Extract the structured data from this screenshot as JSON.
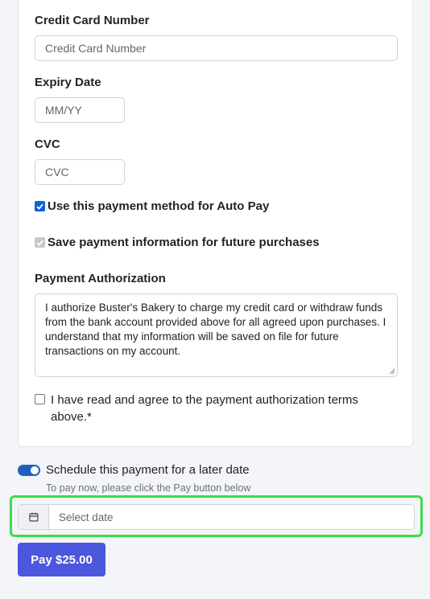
{
  "card_number": {
    "label": "Credit Card Number",
    "placeholder": "Credit Card Number"
  },
  "expiry": {
    "label": "Expiry Date",
    "placeholder": "MM/YY"
  },
  "cvc": {
    "label": "CVC",
    "placeholder": "CVC"
  },
  "auto_pay": {
    "label": "Use this payment method for Auto Pay",
    "checked": true
  },
  "save_info": {
    "label": "Save payment information for future purchases",
    "checked": true,
    "disabled": true
  },
  "authorization": {
    "label": "Payment Authorization",
    "text": "I authorize Buster's Bakery to charge my credit card or withdraw funds from the bank account provided above for all agreed upon purchases. I understand that my information will be saved on file for future transactions on my account."
  },
  "agree": {
    "label": "I have read and agree to the payment authorization terms above.*",
    "checked": false
  },
  "schedule": {
    "label": "Schedule this payment for a later date",
    "enabled": true,
    "hint": "To pay now, please click the Pay button below"
  },
  "date_picker": {
    "placeholder": "Select date",
    "icon": "calendar-icon"
  },
  "pay_button": {
    "label": "Pay $25.00"
  },
  "colors": {
    "accent": "#4b57dc",
    "toggle": "#1f5fbf",
    "checkbox": "#0b63d8",
    "highlight": "#3ddc48"
  }
}
